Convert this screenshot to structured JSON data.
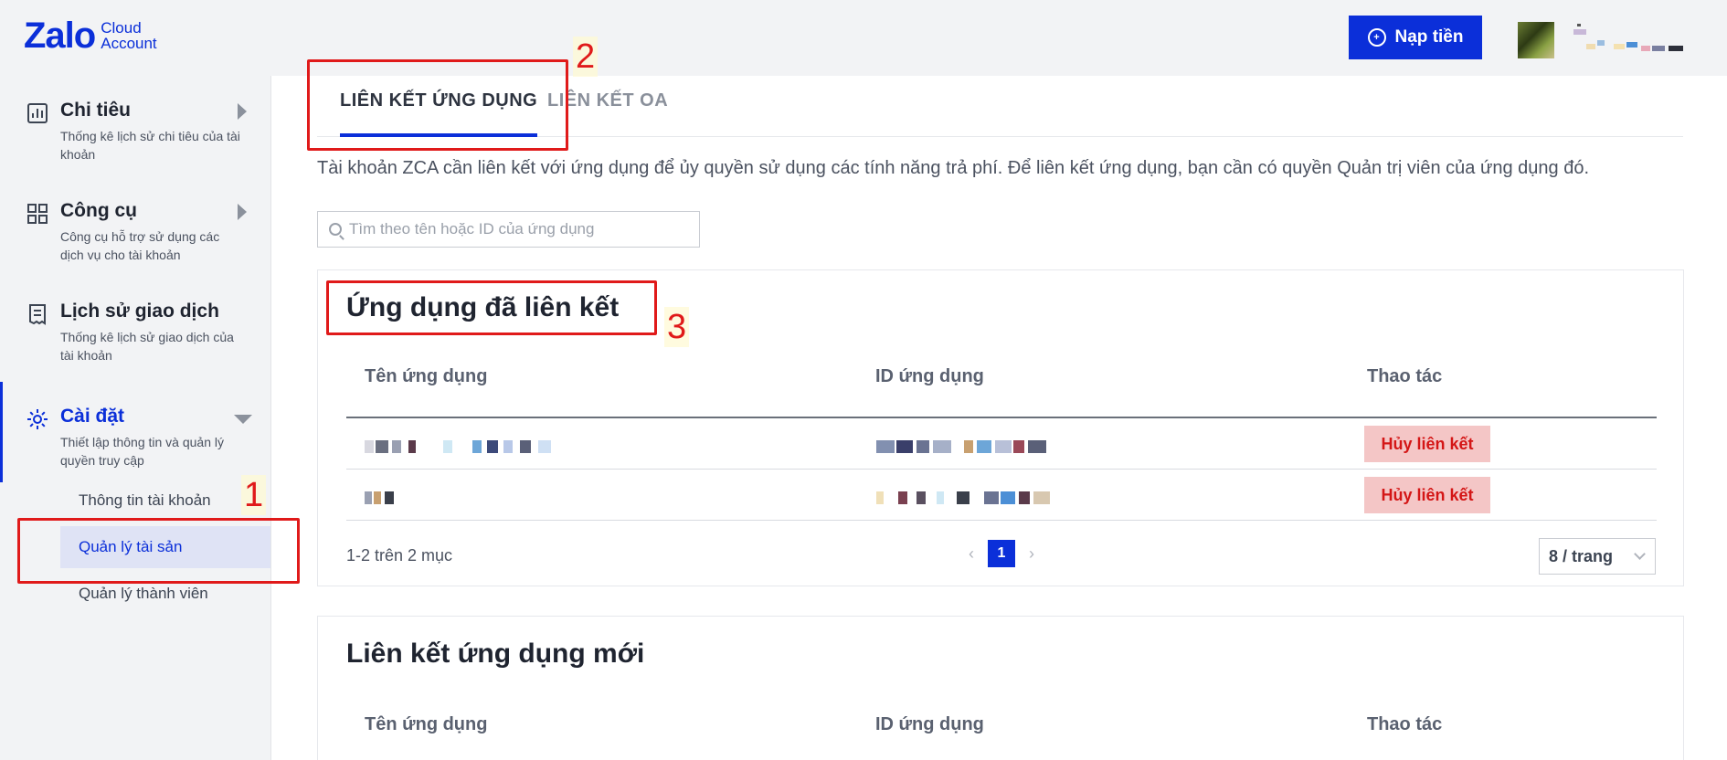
{
  "header": {
    "logo_main": "Zalo",
    "logo_sub_line1": "Cloud",
    "logo_sub_line2": "Account",
    "topup_label": "Nạp tiền",
    "topup_icon": "coin-plus-icon",
    "avatar_icon": "user-avatar"
  },
  "sidebar": {
    "groups": [
      {
        "title": "Chi tiêu",
        "desc": "Thống kê lịch sử chi tiêu của tài khoản",
        "icon": "report-chart-icon"
      },
      {
        "title": "Công cụ",
        "desc": "Công cụ hỗ trợ sử dụng các dịch vụ cho tài khoản",
        "icon": "grid-tools-icon"
      },
      {
        "title": "Lịch sử giao dịch",
        "desc": "Thống kê lịch sử giao dịch của tài khoản",
        "icon": "receipt-icon"
      },
      {
        "title": "Cài đặt",
        "desc": "Thiết lập thông tin và quản lý quyền truy cập",
        "icon": "gear-icon"
      }
    ],
    "sub_items": [
      "Thông tin tài khoản",
      "Quản lý tài sản",
      "Quản lý thành viên"
    ]
  },
  "main": {
    "tabs": [
      "LIÊN KẾT ỨNG DỤNG",
      "LIÊN KẾT OA"
    ],
    "intro": "Tài khoản ZCA cần liên kết với ứng dụng để ủy quyền sử dụng các tính năng trả phí. Để liên kết ứng dụng, bạn cần có quyền Quản trị viên của ứng dụng đó.",
    "search_placeholder": "Tìm theo tên hoặc ID của ứng dụng",
    "linked": {
      "title": "Ứng dụng đã liên kết",
      "columns": [
        "Tên ứng dụng",
        "ID ứng dụng",
        "Thao tác"
      ],
      "row_action": "Hủy liên kết",
      "summary": "1-2 trên 2 mục",
      "current_page": "1",
      "page_size": "8 / trang"
    },
    "new_link": {
      "title": "Liên kết ứng dụng mới",
      "columns": [
        "Tên ứng dụng",
        "ID ứng dụng",
        "Thao tác"
      ]
    }
  },
  "annotations": [
    "1",
    "2",
    "3"
  ],
  "colors": {
    "brand": "#0b2fd9",
    "danger_text": "#d41616",
    "danger_bg": "#f4c6c6",
    "annotation": "#e01a1a"
  }
}
